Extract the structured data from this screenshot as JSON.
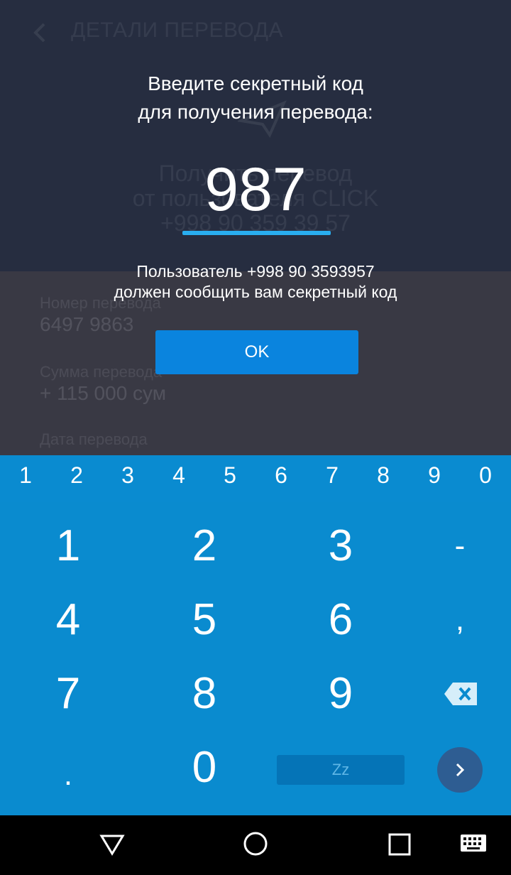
{
  "background": {
    "header_title": "ДЕТАЛИ ПЕРЕВОДА",
    "headline_lines": [
      "Получить перевод",
      "от пользователя CLICK",
      "+998 90 359 39 57"
    ],
    "fields": [
      {
        "label": "Номер перевода",
        "value": "6497 9863"
      },
      {
        "label": "Сумма перевода",
        "value": "+ 115 000 сум"
      },
      {
        "label": "Дата перевода",
        "value": ""
      }
    ]
  },
  "dialog": {
    "prompt_line1": "Введите секретный код",
    "prompt_line2": "для получения перевода:",
    "code_value": "987",
    "hint_line1": "Пользователь +998 90 3593957",
    "hint_line2": "должен сообщить вам секретный код",
    "ok_label": "OK"
  },
  "keyboard": {
    "number_row": [
      "1",
      "2",
      "3",
      "4",
      "5",
      "6",
      "7",
      "8",
      "9",
      "0"
    ],
    "keys": {
      "k1": "1",
      "k2": "2",
      "k3": "3",
      "k4": "4",
      "k5": "5",
      "k6": "6",
      "k7": "7",
      "k8": "8",
      "k9": "9",
      "k0": "0",
      "minus": "-",
      "comma": ",",
      "period": ".",
      "space_label": "Zz"
    },
    "backspace_icon": "backspace-icon",
    "enter_icon": "chevron-right-icon"
  },
  "navbar": {
    "icons": [
      "back-triangle-icon",
      "home-circle-icon",
      "recents-square-icon",
      "keyboard-icon"
    ]
  },
  "colors": {
    "accent": "#29aef0",
    "button": "#0a84de",
    "keyboard_bg": "#0a8bcf"
  }
}
